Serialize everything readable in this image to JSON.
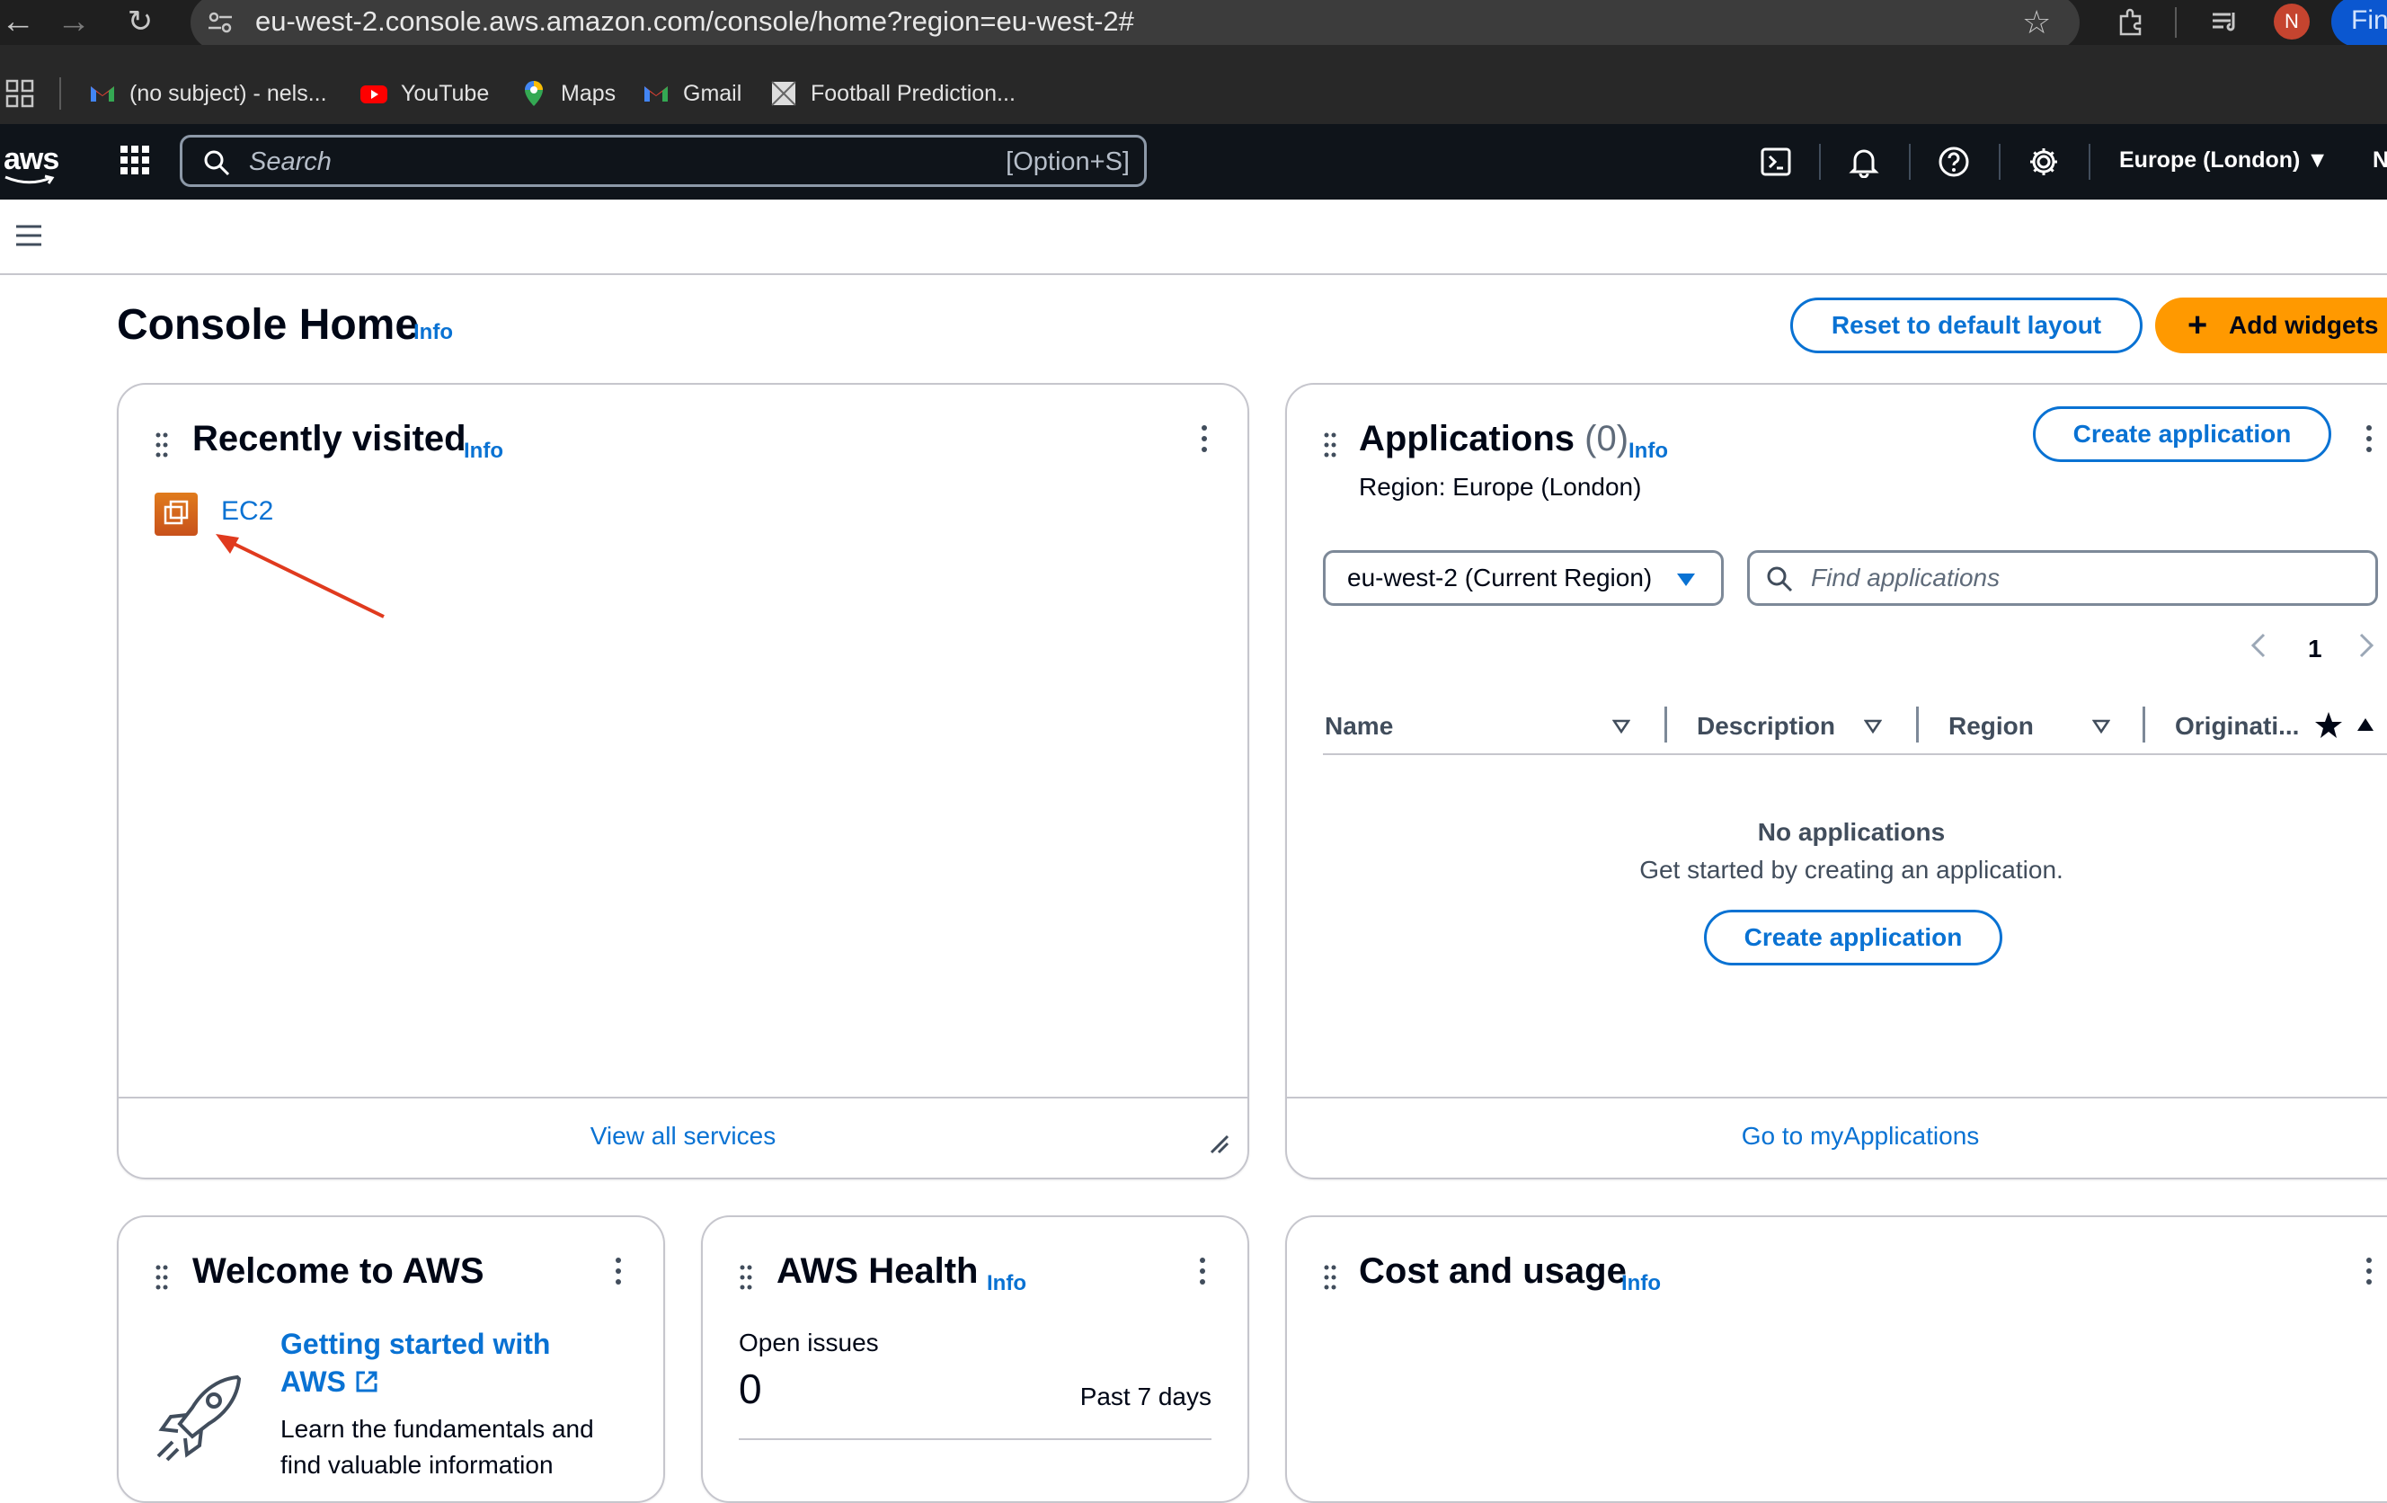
{
  "browser": {
    "url": "eu-west-2.console.aws.amazon.com/console/home?region=eu-west-2#",
    "profile_initial": "N",
    "finish_label": "Fini",
    "bookmarks": [
      {
        "label": "(no subject) - nels..."
      },
      {
        "label": "YouTube"
      },
      {
        "label": "Maps"
      },
      {
        "label": "Gmail"
      },
      {
        "label": "Football Prediction..."
      }
    ]
  },
  "aws_nav": {
    "logo": "aws",
    "search_placeholder": "Search",
    "search_shortcut": "[Option+S]",
    "region": "Europe (London) ▼",
    "account_initial": "N"
  },
  "page": {
    "title": "Console Home",
    "info": "Info",
    "reset_label": "Reset to default layout",
    "add_widgets_plus": "+",
    "add_widgets_label": "Add widgets"
  },
  "recently_visited": {
    "title": "Recently visited",
    "info": "Info",
    "items": [
      {
        "label": "EC2"
      }
    ],
    "footer_link": "View all services"
  },
  "applications": {
    "title": "Applications",
    "count": "(0)",
    "info": "Info",
    "create_label": "Create application",
    "region_label": "Region: Europe (London)",
    "region_select": "eu-west-2 (Current Region)",
    "find_placeholder": "Find applications",
    "page": "1",
    "columns": [
      "Name",
      "Description",
      "Region",
      "Originati..."
    ],
    "empty_title": "No applications",
    "empty_desc": "Get started by creating an application.",
    "empty_create_label": "Create application",
    "footer_link": "Go to myApplications"
  },
  "welcome": {
    "title": "Welcome to AWS",
    "getting_started": "Getting started with AWS",
    "desc": "Learn the fundamentals and find valuable information"
  },
  "health": {
    "title": "AWS Health",
    "info": "Info",
    "open_issues_label": "Open issues",
    "open_issues_count": "0",
    "period": "Past 7 days"
  },
  "cost": {
    "title": "Cost and usage",
    "info": "Info"
  },
  "colors": {
    "link": "#0972d3",
    "accent": "#ff9900",
    "nav_bg": "#0f141a"
  }
}
